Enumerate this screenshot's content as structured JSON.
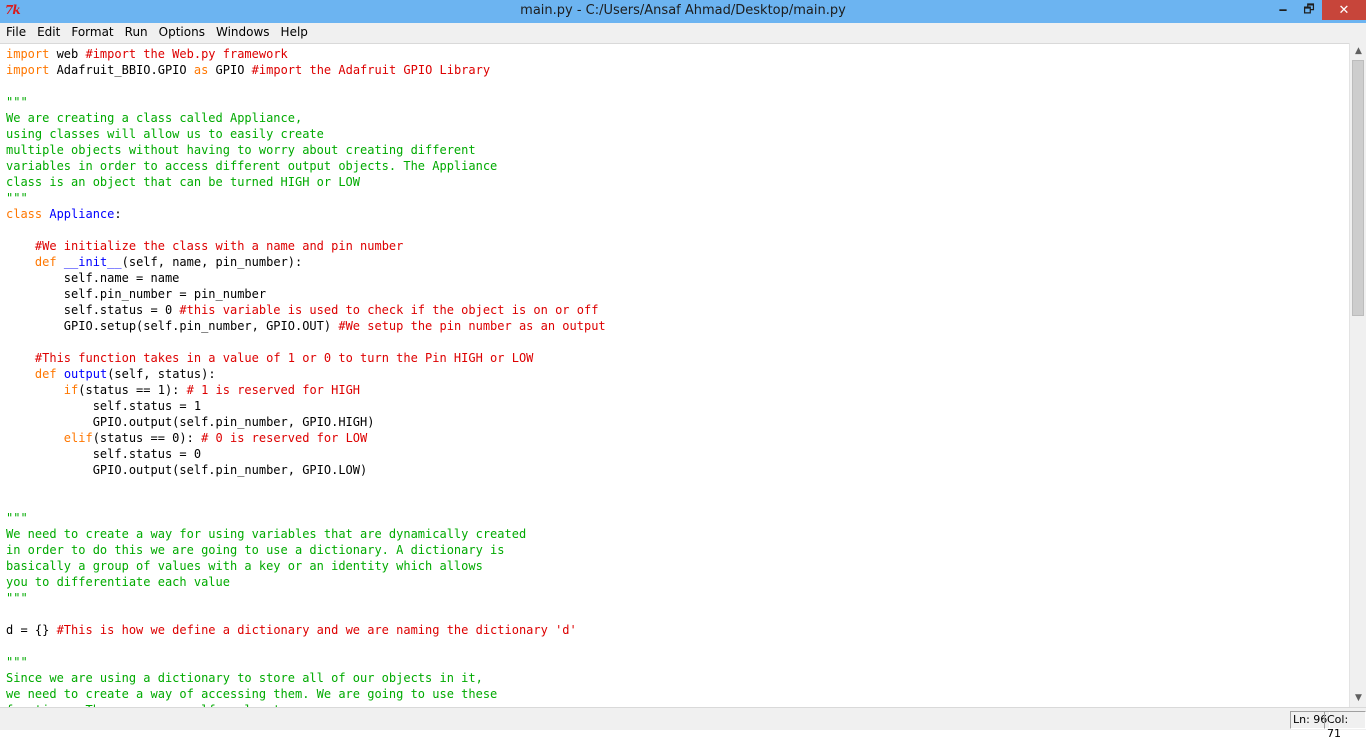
{
  "window": {
    "app_logo": "7k",
    "title": "main.py - C:/Users/Ansaf Ahmad/Desktop/main.py",
    "minimize": "🗕",
    "maximize": "🗗",
    "close": "✕"
  },
  "menu": {
    "items": [
      "File",
      "Edit",
      "Format",
      "Run",
      "Options",
      "Windows",
      "Help"
    ]
  },
  "colors": {
    "keyword": "#ff7700",
    "comment": "#dd0000",
    "string": "#00aa00",
    "definition": "#0000ff",
    "titlebar": "#6cb4f1"
  },
  "editor": {
    "lines": [
      [
        {
          "t": "import",
          "c": "kw"
        },
        {
          "t": " web "
        },
        {
          "t": "#import the Web.py framework",
          "c": "cm"
        }
      ],
      [
        {
          "t": "import",
          "c": "kw"
        },
        {
          "t": " Adafruit_BBIO.GPIO "
        },
        {
          "t": "as",
          "c": "kw"
        },
        {
          "t": " GPIO "
        },
        {
          "t": "#import the Adafruit GPIO Library",
          "c": "cm"
        }
      ],
      [],
      [
        {
          "t": "\"\"\"",
          "c": "st"
        }
      ],
      [
        {
          "t": "We are creating a class called Appliance,",
          "c": "st"
        }
      ],
      [
        {
          "t": "using classes will allow us to easily create",
          "c": "st"
        }
      ],
      [
        {
          "t": "multiple objects without having to worry about creating different",
          "c": "st"
        }
      ],
      [
        {
          "t": "variables in order to access different output objects. The Appliance",
          "c": "st"
        }
      ],
      [
        {
          "t": "class is an object that can be turned HIGH or LOW",
          "c": "st"
        }
      ],
      [
        {
          "t": "\"\"\"",
          "c": "st"
        }
      ],
      [
        {
          "t": "class",
          "c": "kw"
        },
        {
          "t": " "
        },
        {
          "t": "Appliance",
          "c": "df"
        },
        {
          "t": ":"
        }
      ],
      [],
      [
        {
          "t": "    "
        },
        {
          "t": "#We initialize the class with a name and pin number",
          "c": "cm"
        }
      ],
      [
        {
          "t": "    "
        },
        {
          "t": "def",
          "c": "kw"
        },
        {
          "t": " "
        },
        {
          "t": "__init__",
          "c": "df"
        },
        {
          "t": "(self, name, pin_number):"
        }
      ],
      [
        {
          "t": "        self.name = name"
        }
      ],
      [
        {
          "t": "        self.pin_number = pin_number"
        }
      ],
      [
        {
          "t": "        self.status = 0 "
        },
        {
          "t": "#this variable is used to check if the object is on or off",
          "c": "cm"
        }
      ],
      [
        {
          "t": "        GPIO.setup(self.pin_number, GPIO.OUT) "
        },
        {
          "t": "#We setup the pin number as an output",
          "c": "cm"
        }
      ],
      [],
      [
        {
          "t": "    "
        },
        {
          "t": "#This function takes in a value of 1 or 0 to turn the Pin HIGH or LOW",
          "c": "cm"
        }
      ],
      [
        {
          "t": "    "
        },
        {
          "t": "def",
          "c": "kw"
        },
        {
          "t": " "
        },
        {
          "t": "output",
          "c": "df"
        },
        {
          "t": "(self, status):"
        }
      ],
      [
        {
          "t": "        "
        },
        {
          "t": "if",
          "c": "kw"
        },
        {
          "t": "(status == 1): "
        },
        {
          "t": "# 1 is reserved for HIGH",
          "c": "cm"
        }
      ],
      [
        {
          "t": "            self.status = 1"
        }
      ],
      [
        {
          "t": "            GPIO.output(self.pin_number, GPIO.HIGH)"
        }
      ],
      [
        {
          "t": "        "
        },
        {
          "t": "elif",
          "c": "kw"
        },
        {
          "t": "(status == 0): "
        },
        {
          "t": "# 0 is reserved for LOW",
          "c": "cm"
        }
      ],
      [
        {
          "t": "            self.status = 0"
        }
      ],
      [
        {
          "t": "            GPIO.output(self.pin_number, GPIO.LOW)"
        }
      ],
      [],
      [],
      [
        {
          "t": "\"\"\"",
          "c": "st"
        }
      ],
      [
        {
          "t": "We need to create a way for using variables that are dynamically created",
          "c": "st"
        }
      ],
      [
        {
          "t": "in order to do this we are going to use a dictionary. A dictionary is",
          "c": "st"
        }
      ],
      [
        {
          "t": "basically a group of values with a key or an identity which allows",
          "c": "st"
        }
      ],
      [
        {
          "t": "you to differentiate each value",
          "c": "st"
        }
      ],
      [
        {
          "t": "\"\"\"",
          "c": "st"
        }
      ],
      [],
      [
        {
          "t": "d = {} "
        },
        {
          "t": "#This is how we define a dictionary and we are naming the dictionary 'd'",
          "c": "cm"
        }
      ],
      [],
      [
        {
          "t": "\"\"\"",
          "c": "st"
        }
      ],
      [
        {
          "t": "Since we are using a dictionary to store all of our objects in it,",
          "c": "st"
        }
      ],
      [
        {
          "t": "we need to create a way of accessing them. We are going to use these",
          "c": "st"
        }
      ],
      [
        {
          "t": "functions. The names are self explanatory.",
          "c": "st"
        }
      ],
      [
        {
          "t": "\"\"\"",
          "c": "st"
        }
      ]
    ]
  },
  "scrollbar": {
    "up_arrow": "▲",
    "down_arrow": "▼",
    "position": 0.0
  },
  "status": {
    "line": "Ln: 96",
    "column": "Col: 71"
  }
}
